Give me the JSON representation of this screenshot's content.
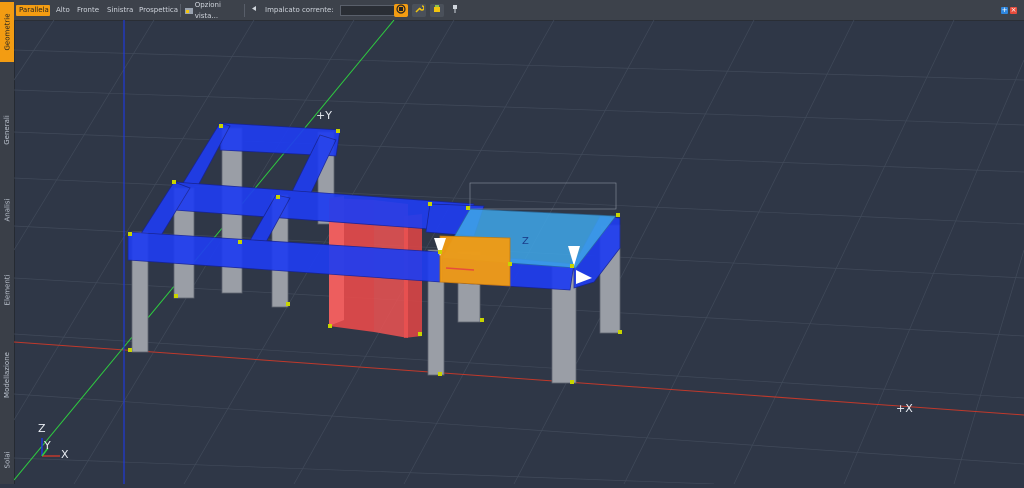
{
  "sidebar": {
    "tabs": [
      {
        "label": "Geometrie",
        "active": true
      },
      {
        "label": "Generali",
        "active": false
      },
      {
        "label": "Analisi",
        "active": false
      },
      {
        "label": "Elementi",
        "active": false
      },
      {
        "label": "Modellazione",
        "active": false
      },
      {
        "label": "Solai",
        "active": false
      }
    ]
  },
  "toolbar": {
    "view_buttons": [
      {
        "label": "Parallela",
        "active": true
      },
      {
        "label": "Alto",
        "active": false
      },
      {
        "label": "Fronte",
        "active": false
      },
      {
        "label": "Sinistra",
        "active": false
      },
      {
        "label": "Prospettica",
        "active": false
      }
    ],
    "options_label": "Opzioni vista...",
    "current_floor_label": "Impalcato corrente:",
    "current_floor_value": ""
  },
  "viewport": {
    "axis_label_y": "+Y",
    "axis_label_x": "+X",
    "triad": {
      "z": "Z",
      "y": "Y",
      "x": "X"
    },
    "colors": {
      "background": "#2f3747",
      "beam": "#1f3df0",
      "column": "#9a9ea6",
      "wall": "#e84a4a",
      "slab": "#3fa6e8",
      "selected": "#f39c12",
      "axis_x": "#c0392b",
      "axis_y": "#2ecc40",
      "axis_z": "#1f3ad9"
    }
  }
}
